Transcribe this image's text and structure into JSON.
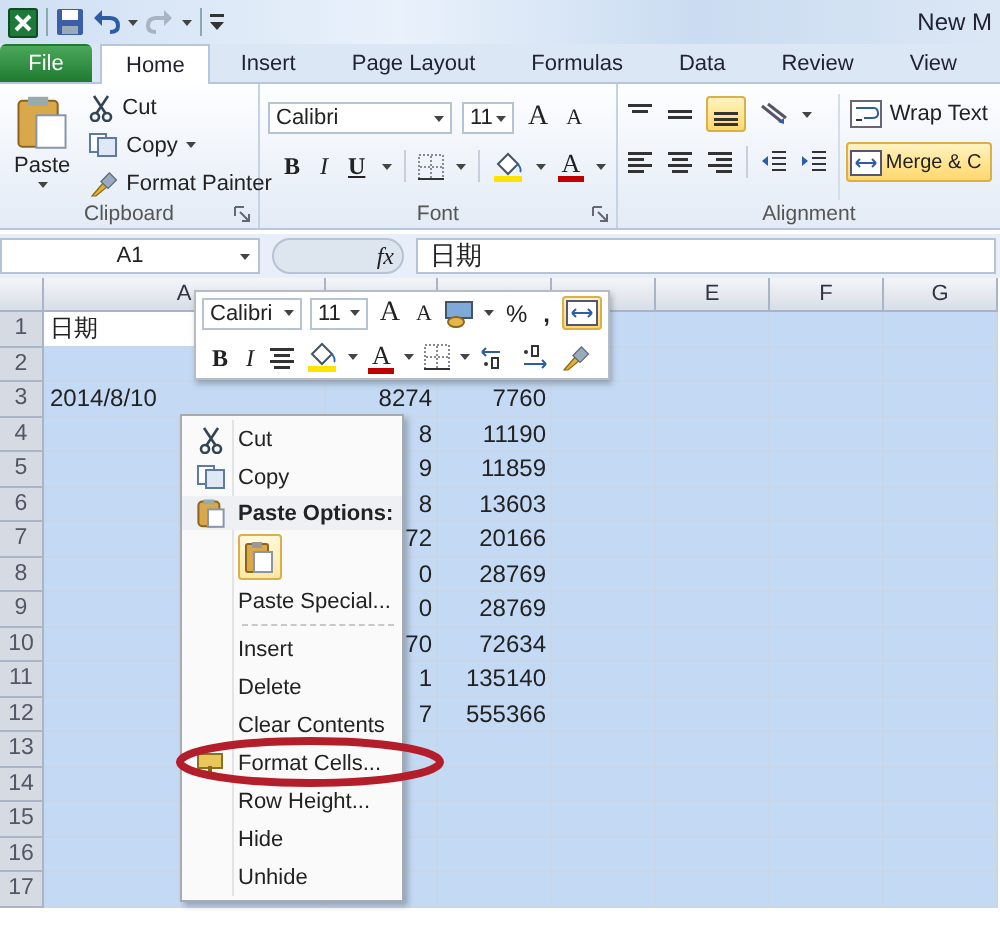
{
  "title_bar": {
    "title": "New M"
  },
  "tabs": [
    {
      "label": "File",
      "kind": "file",
      "selected": false
    },
    {
      "label": "Home",
      "kind": "tab",
      "selected": true
    },
    {
      "label": "Insert",
      "kind": "tab",
      "selected": false
    },
    {
      "label": "Page Layout",
      "kind": "tab",
      "selected": false
    },
    {
      "label": "Formulas",
      "kind": "tab",
      "selected": false
    },
    {
      "label": "Data",
      "kind": "tab",
      "selected": false
    },
    {
      "label": "Review",
      "kind": "tab",
      "selected": false
    },
    {
      "label": "View",
      "kind": "tab",
      "selected": false
    }
  ],
  "clipboard": {
    "paste": "Paste",
    "cut": "Cut",
    "copy": "Copy",
    "format_painter": "Format Painter",
    "group": "Clipboard"
  },
  "font": {
    "font_name": "Calibri",
    "font_size": "11",
    "grow_font": "A",
    "shrink_font": "A",
    "bold": "B",
    "italic": "I",
    "underline": "U",
    "font_color": "A",
    "group": "Font"
  },
  "alignment": {
    "bottom_align_selected": true,
    "wrap_text": "Wrap Text",
    "merge": "Merge & C",
    "merge_selected": true,
    "group": "Alignment"
  },
  "formula_bar": {
    "name_box": "A1",
    "fx": "fx",
    "value": "日期"
  },
  "sheet": {
    "all_selected": true,
    "columns": [
      {
        "label": "A"
      },
      {
        "covered": true
      },
      {
        "covered": true
      },
      {
        "covered": true
      },
      {
        "label": "E"
      },
      {
        "label": "F"
      },
      {
        "label": "G"
      }
    ],
    "rows": [
      {
        "number": "1",
        "cells": [
          "日期"
        ]
      },
      {
        "number": "2"
      },
      {
        "number": "3",
        "cells": [
          "2014/8/10",
          "8274",
          "7760"
        ]
      },
      {
        "number": "4",
        "cells": [
          null,
          "8",
          "11190"
        ]
      },
      {
        "number": "5",
        "cells": [
          null,
          "9",
          "11859"
        ]
      },
      {
        "number": "6",
        "cells": [
          null,
          "8",
          "13603"
        ]
      },
      {
        "number": "7",
        "cells": [
          null,
          "72",
          "20166"
        ]
      },
      {
        "number": "8",
        "cells": [
          null,
          "0",
          "28769"
        ]
      },
      {
        "number": "9",
        "cells": [
          null,
          "0",
          "28769"
        ]
      },
      {
        "number": "10",
        "cells": [
          null,
          "70",
          "72634"
        ]
      },
      {
        "number": "11",
        "cells": [
          null,
          "1",
          "135140"
        ]
      },
      {
        "number": "12",
        "cells": [
          null,
          "7",
          "555366"
        ]
      },
      {
        "number": "13"
      },
      {
        "number": "14"
      },
      {
        "number": "15"
      },
      {
        "number": "16"
      },
      {
        "number": "17"
      }
    ]
  },
  "mini_toolbar": {
    "font_name": "Calibri",
    "font_size": "11",
    "grow_font": "A",
    "shrink_font": "A",
    "percent": "%",
    "comma": ",",
    "merge_selected": true,
    "bold": "B",
    "italic": "I",
    "font_color": "A"
  },
  "context_menu": {
    "items": [
      {
        "kind": "command",
        "label": "Cut"
      },
      {
        "kind": "command",
        "label": "Copy"
      },
      {
        "kind": "header",
        "label": "Paste Options:"
      },
      {
        "kind": "paste-buttons"
      },
      {
        "kind": "command",
        "label": "Paste Special..."
      },
      {
        "kind": "separator"
      },
      {
        "kind": "command",
        "label": "Insert"
      },
      {
        "kind": "command",
        "label": "Delete"
      },
      {
        "kind": "command",
        "label": "Clear Contents"
      },
      {
        "kind": "command",
        "label": "Format Cells..."
      },
      {
        "kind": "command",
        "label": "Row Height..."
      },
      {
        "kind": "command",
        "label": "Hide"
      },
      {
        "kind": "command",
        "label": "Unhide"
      }
    ]
  },
  "annotation": {
    "kind": "ellipse"
  }
}
